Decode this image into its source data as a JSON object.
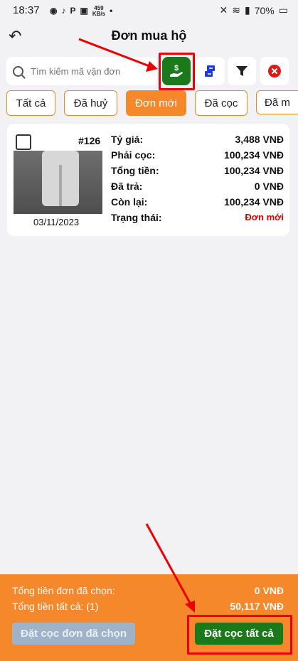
{
  "status": {
    "time": "18:37",
    "speed": "459\nKB/s",
    "battery": "70%"
  },
  "header": {
    "title": "Đơn mua hộ"
  },
  "search": {
    "placeholder": "Tìm kiếm mã vận đơn"
  },
  "tabs": [
    {
      "label": "Tất cả"
    },
    {
      "label": "Đã huỷ"
    },
    {
      "label": "Đơn mới"
    },
    {
      "label": "Đã cọc"
    },
    {
      "label": "Đã m"
    }
  ],
  "order": {
    "id": "#126",
    "date": "03/11/2023",
    "rows": [
      {
        "label": "Tỷ giá:",
        "value": "3,488 VNĐ"
      },
      {
        "label": "Phải cọc:",
        "value": "100,234 VNĐ"
      },
      {
        "label": "Tổng tiền:",
        "value": "100,234 VNĐ"
      },
      {
        "label": "Đã trả:",
        "value": "0 VNĐ"
      },
      {
        "label": "Còn lại:",
        "value": "100,234 VNĐ"
      },
      {
        "label": "Trạng thái:",
        "value": "Đơn mới"
      }
    ]
  },
  "footer": {
    "selected_label": "Tổng tiền đơn đã chọn:",
    "selected_value": "0 VNĐ",
    "total_label": "Tổng tiền tất cả: (1)",
    "total_value": "50,117 VNĐ",
    "deposit_selected_button": "Đặt cọc đơn đã chọn",
    "deposit_all_button": "Đặt cọc tất cả"
  },
  "colors": {
    "accent": "#f5882a",
    "green": "#1a7a1a",
    "red": "#d90000"
  }
}
